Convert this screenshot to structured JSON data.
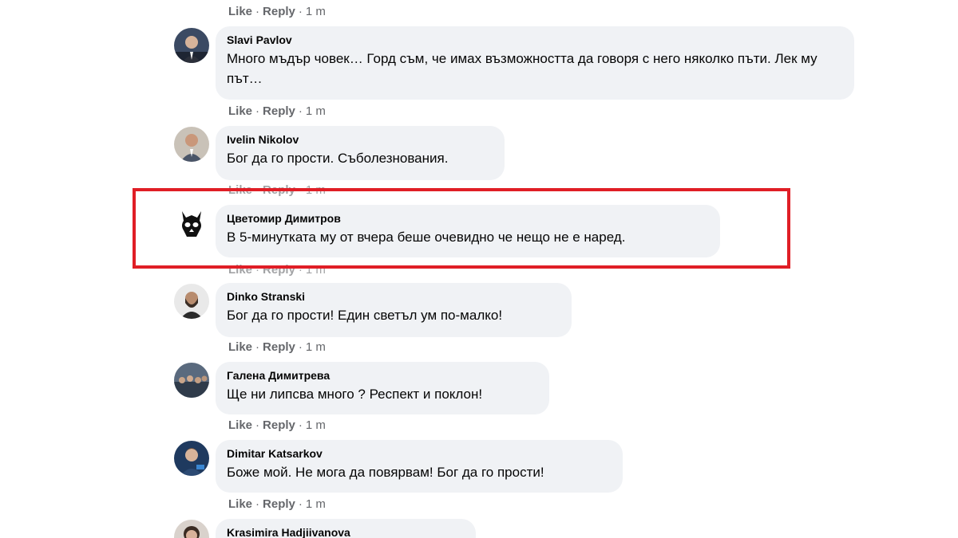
{
  "actions": {
    "like": "Like",
    "reply": "Reply",
    "dot": "·"
  },
  "comments": [
    {
      "author": "Slavi Pavlov",
      "text": "Много мъдър човек… Горд съм, че имах възможността да говоря с него няколко пъти. Лек му път…",
      "time": "1 m"
    },
    {
      "author": "Ivelin Nikolov",
      "text": "Бог да го прости. Съболезнования.",
      "time": "1 m"
    },
    {
      "author": "Цветомир Димитров",
      "text": "В 5-минутката му от вчера беше очевидно че нещо не е наред.",
      "time": "1 m"
    },
    {
      "author": "Dinko Stranski",
      "text": "Бог да го прости! Един светъл ум по-малко!",
      "time": "1 m"
    },
    {
      "author": "Галена Димитрева",
      "text": "Ще ни липсва много ? Респект и поклон!",
      "time": "1 m"
    },
    {
      "author": "Dimitar Katsarkov",
      "text": "Боже мой. Не мога да повярвам! Бог да го прости!",
      "time": "1 m"
    },
    {
      "author": "Krasimira Hadjiivanova",
      "text": "",
      "time": ""
    }
  ],
  "top_meta": {
    "time": "1 m"
  },
  "colors": {
    "bubble": "#f0f2f5",
    "meta": "#65676b",
    "highlight": "#e01e26"
  }
}
